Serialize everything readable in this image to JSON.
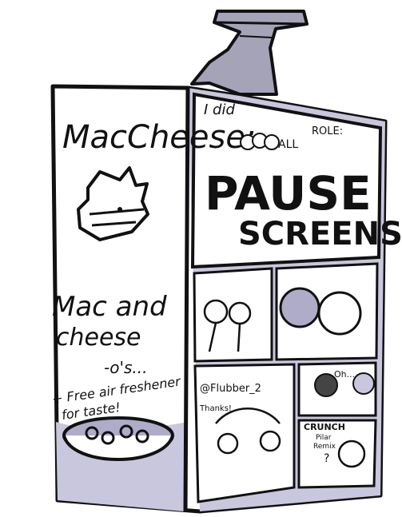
{
  "box": {
    "brand": "MacCheese:",
    "product_line1": "Mac and",
    "product_line2": "cheese",
    "product_suffix": "-o's...",
    "tagline_line1": "+ Free air freshener",
    "tagline_line2": "for taste!"
  },
  "panel_top": {
    "caption": "I did",
    "all_label": "ALL",
    "role_label": "ROLE:",
    "title_word1": "PAUSE",
    "title_word2": "SCREENS"
  },
  "comics": {
    "handle": "@Flubber_2",
    "thanks": "Thanks!",
    "exclaim_oh": "Oh...",
    "crunch": "CRUNCH",
    "pilar": "Pilar",
    "remix": "Remix",
    "question": "?"
  },
  "colors": {
    "ink": "#111111",
    "lavender": "#c8c7dd",
    "lavender_dark": "#aeacc8",
    "spray_gray": "#a4a3b8",
    "paper": "#ffffff"
  }
}
